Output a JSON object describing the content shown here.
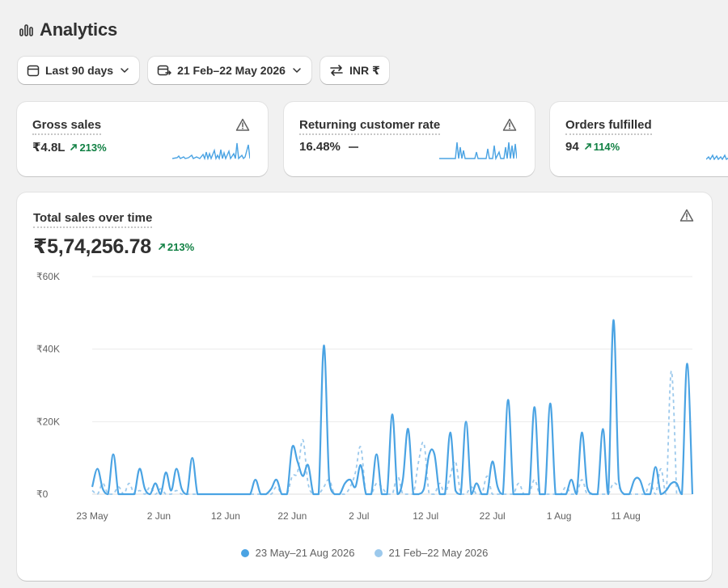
{
  "header": {
    "title": "Analytics",
    "icon": "bar-chart-icon"
  },
  "filters": {
    "range_label": "Last 90 days",
    "compare_label": "21 Feb–22 May 2026",
    "currency_label": "INR ₹"
  },
  "metrics": [
    {
      "label": "Gross sales",
      "value": "₹4.8L",
      "change": "213%",
      "trend": "up"
    },
    {
      "label": "Returning customer rate",
      "value": "16.48%",
      "change": "",
      "trend": "flat"
    },
    {
      "label": "Orders fulfilled",
      "value": "94",
      "change": "114%",
      "trend": "up"
    }
  ],
  "chart": {
    "title": "Total sales over time",
    "total": "₹5,74,256.78",
    "change": "213%"
  },
  "colors": {
    "primary": "#4aa3e3",
    "comparison": "#9cc9ec",
    "positive": "#108043"
  },
  "chart_data": {
    "type": "line",
    "title": "Total sales over time",
    "ylim": [
      0,
      60000
    ],
    "y_ticks": [
      "₹0",
      "₹20K",
      "₹40K",
      "₹60K"
    ],
    "y_tick_values": [
      0,
      20000,
      40000,
      60000
    ],
    "x_tick_labels": [
      "23 May",
      "2 Jun",
      "12 Jun",
      "22 Jun",
      "2 Jul",
      "12 Jul",
      "22 Jul",
      "1 Aug",
      "11 Aug"
    ],
    "x_tick_days": [
      0,
      10,
      20,
      30,
      40,
      50,
      60,
      70,
      80
    ],
    "grid": true,
    "legend_position": "bottom",
    "series": [
      {
        "name": "23 May–21 Aug 2026",
        "style": "solid",
        "values": [
          2000,
          7000,
          1500,
          0,
          11000,
          0,
          0,
          0,
          0,
          7000,
          1500,
          0,
          3000,
          0,
          6000,
          1000,
          7000,
          1500,
          0,
          10000,
          0,
          0,
          0,
          0,
          0,
          0,
          0,
          0,
          0,
          0,
          0,
          4000,
          0,
          0,
          1500,
          4000,
          0,
          0,
          13000,
          9000,
          5000,
          8000,
          0,
          0,
          41000,
          4000,
          0,
          0,
          3000,
          4000,
          2000,
          8000,
          0,
          0,
          11000,
          0,
          0,
          22000,
          0,
          4000,
          18000,
          0,
          0,
          1500,
          11000,
          11000,
          0,
          0,
          17000,
          1000,
          0,
          20000,
          0,
          3000,
          0,
          0,
          9000,
          2000,
          0,
          26000,
          0,
          0,
          0,
          0,
          24000,
          0,
          0,
          25000,
          0,
          0,
          0,
          4000,
          0,
          17000,
          2000,
          0,
          0,
          18000,
          0,
          48000,
          4000,
          0,
          0,
          4000,
          4000,
          0,
          0,
          7500,
          0,
          1000,
          3000,
          3000,
          0,
          36000,
          0
        ]
      },
      {
        "name": "21 Feb–22 May 2026",
        "style": "dashed",
        "values": [
          1000,
          0,
          3000,
          0,
          0,
          2000,
          0,
          3000,
          0,
          1000,
          0,
          2000,
          0,
          1500,
          0,
          0,
          1000,
          0,
          0,
          0,
          0,
          0,
          0,
          0,
          0,
          0,
          0,
          0,
          0,
          0,
          0,
          0,
          0,
          0,
          0,
          2000,
          0,
          0,
          5000,
          6000,
          15000,
          3000,
          0,
          0,
          2000,
          4000,
          0,
          0,
          0,
          2000,
          6000,
          13000,
          0,
          0,
          3000,
          2000,
          0,
          0,
          5000,
          0,
          0,
          0,
          9000,
          14000,
          0,
          0,
          3000,
          0,
          5000,
          9000,
          0,
          0,
          2000,
          0,
          0,
          5000,
          0,
          0,
          0,
          0,
          0,
          3000,
          0,
          0,
          4000,
          0,
          0,
          0,
          0,
          0,
          2000,
          0,
          0,
          4000,
          0,
          0,
          0,
          0,
          0,
          3000,
          2000,
          0,
          0,
          0,
          0,
          0,
          3000,
          0,
          7000,
          0,
          34000,
          0
        ]
      }
    ]
  }
}
